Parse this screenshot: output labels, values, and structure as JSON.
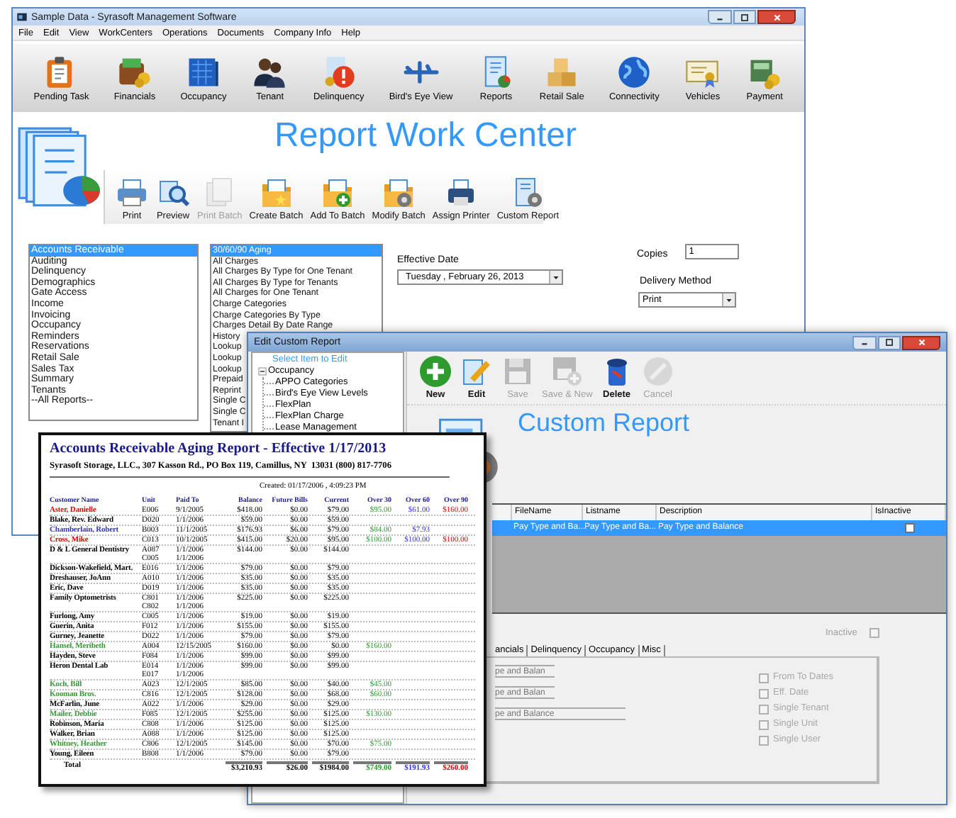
{
  "main_window": {
    "title": "Sample Data - Syrasoft Management Software",
    "menu": [
      "File",
      "Edit",
      "View",
      "WorkCenters",
      "Operations",
      "Documents",
      "Company Info",
      "Help"
    ],
    "toolbar": [
      {
        "label": "Pending Task"
      },
      {
        "label": "Financials"
      },
      {
        "label": "Occupancy"
      },
      {
        "label": "Tenant"
      },
      {
        "label": "Delinquency"
      },
      {
        "label": "Bird's Eye View"
      },
      {
        "label": "Reports"
      },
      {
        "label": "Retail Sale"
      },
      {
        "label": "Connectivity"
      },
      {
        "label": "Vehicles"
      },
      {
        "label": "Payment"
      }
    ],
    "heading": "Report Work Center",
    "report_toolbar": [
      {
        "label": "Print",
        "disabled": false
      },
      {
        "label": "Preview",
        "disabled": false
      },
      {
        "label": "Print Batch",
        "disabled": true
      },
      {
        "label": "Create Batch",
        "disabled": false
      },
      {
        "label": "Add To Batch",
        "disabled": false
      },
      {
        "label": "Modify Batch",
        "disabled": false
      },
      {
        "label": "Assign Printer",
        "disabled": false
      },
      {
        "label": "Custom Report",
        "disabled": false
      }
    ],
    "categories": [
      {
        "label": "Accounts Receivable",
        "selected": true
      },
      {
        "label": "Auditing",
        "selected": false
      },
      {
        "label": "Delinquency",
        "selected": false
      },
      {
        "label": "Demographics",
        "selected": false
      },
      {
        "label": "Gate Access",
        "selected": false
      },
      {
        "label": "Income",
        "selected": false
      },
      {
        "label": "Invoicing",
        "selected": false
      },
      {
        "label": "Occupancy",
        "selected": false
      },
      {
        "label": "Reminders",
        "selected": false
      },
      {
        "label": "Reservations",
        "selected": false
      },
      {
        "label": "Retail Sale",
        "selected": false
      },
      {
        "label": "Sales Tax",
        "selected": false
      },
      {
        "label": "Summary",
        "selected": false
      },
      {
        "label": "Tenants",
        "selected": false
      },
      {
        "label": "--All Reports--",
        "selected": false
      }
    ],
    "reports": [
      {
        "label": "30/60/90 Aging",
        "selected": true
      },
      {
        "label": "All Charges",
        "selected": false
      },
      {
        "label": "All Charges By Type for One Tenant",
        "selected": false
      },
      {
        "label": "All Charges By Type for Tenants",
        "selected": false
      },
      {
        "label": "All Charges for One Tenant",
        "selected": false
      },
      {
        "label": "Charge Categories",
        "selected": false
      },
      {
        "label": "Charge Categories By Type",
        "selected": false
      },
      {
        "label": "Charges Detail By Date Range",
        "selected": false
      },
      {
        "label": "History",
        "selected": false
      },
      {
        "label": "Lookup",
        "selected": false
      },
      {
        "label": "Lookup",
        "selected": false
      },
      {
        "label": "Lookup",
        "selected": false
      },
      {
        "label": "Prepaid",
        "selected": false
      },
      {
        "label": "Reprint",
        "selected": false
      },
      {
        "label": "Single C",
        "selected": false
      },
      {
        "label": "Single C",
        "selected": false
      },
      {
        "label": "Tenant I",
        "selected": false
      }
    ],
    "effective_date": {
      "label": "Effective Date",
      "value": "Tuesday , February 26, 2013"
    },
    "copies": {
      "label": "Copies",
      "value": "1"
    },
    "delivery_method": {
      "label": "Delivery Method",
      "value": "Print"
    }
  },
  "edit_window": {
    "title": "Edit Custom Report",
    "tree": {
      "header": "Select Item to Edit",
      "nodes": [
        {
          "label": "Occupancy",
          "expanded": true,
          "children": [
            {
              "label": "APPO Categories"
            },
            {
              "label": "Bird's Eye View Levels"
            },
            {
              "label": "FlexPlan"
            },
            {
              "label": "FlexPlan Charge"
            },
            {
              "label": "Lease Management"
            }
          ]
        }
      ]
    },
    "toolbar": [
      {
        "label": "New",
        "disabled": false
      },
      {
        "label": "Edit",
        "disabled": false
      },
      {
        "label": "Save",
        "disabled": true
      },
      {
        "label": "Save & New",
        "disabled": true
      },
      {
        "label": "Delete",
        "disabled": false
      },
      {
        "label": "Cancel",
        "disabled": true
      }
    ],
    "heading": "Custom Report",
    "grid": {
      "columns": [
        "FileName",
        "Listname",
        "Description",
        "IsInactive"
      ],
      "rows": [
        {
          "file_name": "Pay Type and Ba...",
          "list_name": "Pay Type and Ba...",
          "description": "Pay Type and Balance",
          "inactive": false,
          "selected": true
        }
      ]
    },
    "inactive": {
      "label": "Inactive",
      "checked": false,
      "disabled": true
    },
    "tabs": [
      {
        "label": "ancials"
      },
      {
        "label": "Delinquency"
      },
      {
        "label": "Occupancy"
      },
      {
        "label": "Misc"
      }
    ],
    "fields": [
      "pe and Balan",
      "pe and Balan",
      "pe and Balance"
    ],
    "options": [
      {
        "label": "From To Dates",
        "checked": false,
        "disabled": true
      },
      {
        "label": "Eff. Date",
        "checked": false,
        "disabled": true
      },
      {
        "label": "Single Tenant",
        "checked": false,
        "disabled": true
      },
      {
        "label": "Single Unit",
        "checked": false,
        "disabled": true
      },
      {
        "label": "Single User",
        "checked": false,
        "disabled": true
      }
    ]
  },
  "report": {
    "title": "Accounts Receivable Aging Report - Effective 1/17/2013",
    "subtitle": "Syrasoft Storage, LLC., 307 Kasson Rd., PO Box 119, Camillus, NY  13031 (800) 817-7706",
    "created": "Created: 01/17/2006 , 4:09:23 PM",
    "columns": [
      "Customer Name",
      "Unit",
      "Paid To",
      "Balance",
      "Future Bills",
      "Current",
      "Over 30",
      "Over 60",
      "Over 90"
    ],
    "rows": [
      {
        "name": "Aster, Danielle",
        "color": "#e00000",
        "units": [
          "E006"
        ],
        "paid_to": [
          "9/1/2005"
        ],
        "balance": "$418.00",
        "future_bills": "$0.00",
        "current": "$79.00",
        "over_30": "$95.00",
        "over_60": "$61.00",
        "over_90": "$160.00"
      },
      {
        "name": "Blake, Rev. Edward",
        "color": "#000000",
        "units": [
          "D020"
        ],
        "paid_to": [
          "1/1/2006"
        ],
        "balance": "$59.00",
        "future_bills": "$0.00",
        "current": "$59.00"
      },
      {
        "name": "Chamberlain, Robert",
        "color": "#3333cc",
        "units": [
          "B003"
        ],
        "paid_to": [
          "11/1/2005"
        ],
        "balance": "$176.93",
        "future_bills": "$6.00",
        "current": "$79.00",
        "over_30": "$84.00",
        "over_60": "$7.93"
      },
      {
        "name": "Cross, Mike",
        "color": "#e00000",
        "units": [
          "C013"
        ],
        "paid_to": [
          "10/1/2005"
        ],
        "balance": "$415.00",
        "future_bills": "$20.00",
        "current": "$95.00",
        "over_30": "$100.00",
        "over_60": "$100.00",
        "over_90": "$100.00"
      },
      {
        "name": "D & L General Dentistry",
        "color": "#000000",
        "units": [
          "A087",
          "C005"
        ],
        "paid_to": [
          "1/1/2006",
          "1/1/2006"
        ],
        "balance": "$144.00",
        "future_bills": "$0.00",
        "current": "$144.00"
      },
      {
        "name": "Dickson-Wakefield, Mart.",
        "color": "#000000",
        "units": [
          "E016"
        ],
        "paid_to": [
          "1/1/2006"
        ],
        "balance": "$79.00",
        "future_bills": "$0.00",
        "current": "$79.00"
      },
      {
        "name": "Dreshauser, JoAnn",
        "color": "#000000",
        "units": [
          "A010"
        ],
        "paid_to": [
          "1/1/2006"
        ],
        "balance": "$35.00",
        "future_bills": "$0.00",
        "current": "$35.00"
      },
      {
        "name": "Eric, Dave",
        "color": "#000000",
        "units": [
          "D019"
        ],
        "paid_to": [
          "1/1/2006"
        ],
        "balance": "$35.00",
        "future_bills": "$0.00",
        "current": "$35.00"
      },
      {
        "name": "Family Optometrists",
        "color": "#000000",
        "units": [
          "C801",
          "C802"
        ],
        "paid_to": [
          "1/1/2006",
          "1/1/2006"
        ],
        "balance": "$225.00",
        "future_bills": "$0.00",
        "current": "$225.00"
      },
      {
        "name": "Furlong, Amy",
        "color": "#000000",
        "units": [
          "C005"
        ],
        "paid_to": [
          "1/1/2006"
        ],
        "balance": "$19.00",
        "future_bills": "$0.00",
        "current": "$19.00"
      },
      {
        "name": "Guerin, Anita",
        "color": "#000000",
        "units": [
          "F012"
        ],
        "paid_to": [
          "1/1/2006"
        ],
        "balance": "$155.00",
        "future_bills": "$0.00",
        "current": "$155.00"
      },
      {
        "name": "Gurney, Jeanette",
        "color": "#000000",
        "units": [
          "D022"
        ],
        "paid_to": [
          "1/1/2006"
        ],
        "balance": "$79.00",
        "future_bills": "$0.00",
        "current": "$79.00"
      },
      {
        "name": "Hansel, Meribeth",
        "color": "#339933",
        "units": [
          "A004"
        ],
        "paid_to": [
          "12/15/2005"
        ],
        "balance": "$160.00",
        "future_bills": "$0.00",
        "current": "$0.00",
        "over_30": "$160.00"
      },
      {
        "name": "Hayden, Steve",
        "color": "#000000",
        "units": [
          "F084"
        ],
        "paid_to": [
          "1/1/2006"
        ],
        "balance": "$99.00",
        "future_bills": "$0.00",
        "current": "$99.00"
      },
      {
        "name": "Heron Dental Lab",
        "color": "#000000",
        "units": [
          "E014",
          "E017"
        ],
        "paid_to": [
          "1/1/2006",
          "1/1/2006"
        ],
        "balance": "$99.00",
        "future_bills": "$0.00",
        "current": "$99.00"
      },
      {
        "name": "Koch, Bill",
        "color": "#339933",
        "units": [
          "A023"
        ],
        "paid_to": [
          "12/1/2005"
        ],
        "balance": "$85.00",
        "future_bills": "$0.00",
        "current": "$40.00",
        "over_30": "$45.00"
      },
      {
        "name": "Kooman Bros.",
        "color": "#339933",
        "units": [
          "C816"
        ],
        "paid_to": [
          "12/1/2005"
        ],
        "balance": "$128.00",
        "future_bills": "$0.00",
        "current": "$68.00",
        "over_30": "$60.00"
      },
      {
        "name": "McFarlin, June",
        "color": "#000000",
        "units": [
          "A022"
        ],
        "paid_to": [
          "1/1/2006"
        ],
        "balance": "$29.00",
        "future_bills": "$0.00",
        "current": "$29.00"
      },
      {
        "name": "Mailer, Debbie",
        "color": "#339933",
        "units": [
          "F085"
        ],
        "paid_to": [
          "12/1/2005"
        ],
        "balance": "$255.00",
        "future_bills": "$0.00",
        "current": "$125.00",
        "over_30": "$130.00"
      },
      {
        "name": "Robinson, Maria",
        "color": "#000000",
        "units": [
          "C808"
        ],
        "paid_to": [
          "1/1/2006"
        ],
        "balance": "$125.00",
        "future_bills": "$0.00",
        "current": "$125.00"
      },
      {
        "name": "Walker, Brian",
        "color": "#000000",
        "units": [
          "A088"
        ],
        "paid_to": [
          "1/1/2006"
        ],
        "balance": "$125.00",
        "future_bills": "$0.00",
        "current": "$125.00"
      },
      {
        "name": "Whitney, Heather",
        "color": "#339933",
        "units": [
          "C806"
        ],
        "paid_to": [
          "12/1/2005"
        ],
        "balance": "$145.00",
        "future_bills": "$0.00",
        "current": "$70.00",
        "over_30": "$75.00"
      },
      {
        "name": "Young, Eileen",
        "color": "#000000",
        "units": [
          "B808"
        ],
        "paid_to": [
          "1/1/2006"
        ],
        "balance": "$79.00",
        "future_bills": "$0.00",
        "current": "$79.00"
      }
    ],
    "total": {
      "label": "Total",
      "balance": "$3,210.93",
      "future_bills": "$26.00",
      "current": "$1984.00",
      "over_30": "$749.00",
      "over_60": "$191.93",
      "over_90": "$260.00"
    }
  }
}
